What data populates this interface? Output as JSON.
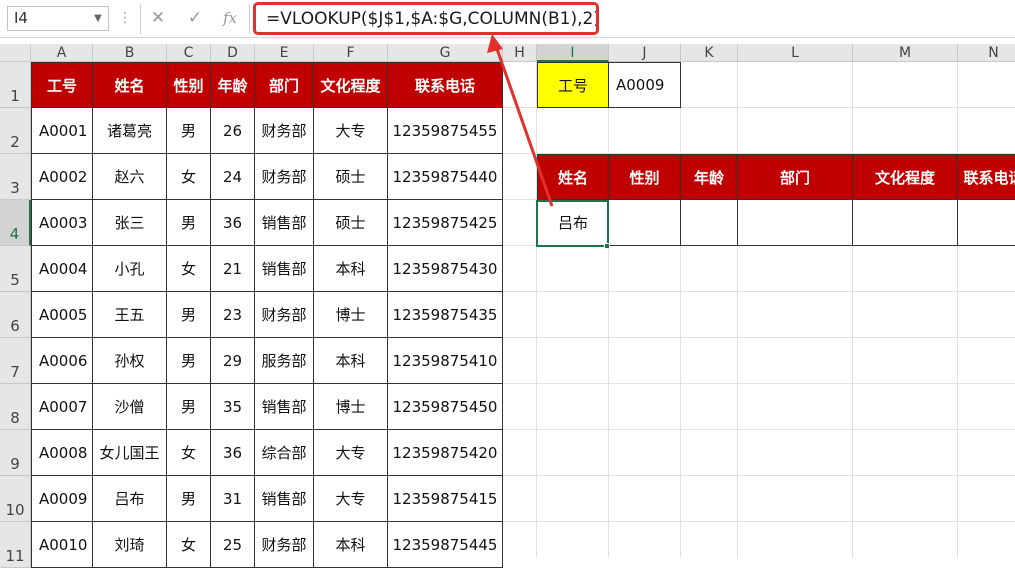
{
  "formula_bar": {
    "name_box": "I4",
    "cancel_icon": "✕",
    "enter_icon": "✓",
    "fx_label": "fx",
    "formula": "=VLOOKUP($J$1,$A:$G,COLUMN(B1),2)"
  },
  "columns": [
    "A",
    "B",
    "C",
    "D",
    "E",
    "F",
    "G",
    "H",
    "I",
    "J",
    "K",
    "L",
    "M",
    "N"
  ],
  "rows": [
    "1",
    "2",
    "3",
    "4",
    "5",
    "6",
    "7",
    "8",
    "9",
    "10",
    "11"
  ],
  "table": {
    "headers": [
      "工号",
      "姓名",
      "性别",
      "年龄",
      "部门",
      "文化程度",
      "联系电话"
    ],
    "records": [
      [
        "A0001",
        "诸葛亮",
        "男",
        "26",
        "财务部",
        "大专",
        "12359875455"
      ],
      [
        "A0002",
        "赵六",
        "女",
        "24",
        "财务部",
        "硕士",
        "12359875440"
      ],
      [
        "A0003",
        "张三",
        "男",
        "36",
        "销售部",
        "硕士",
        "12359875425"
      ],
      [
        "A0004",
        "小孔",
        "女",
        "21",
        "销售部",
        "本科",
        "12359875430"
      ],
      [
        "A0005",
        "王五",
        "男",
        "23",
        "财务部",
        "博士",
        "12359875435"
      ],
      [
        "A0006",
        "孙权",
        "男",
        "29",
        "服务部",
        "本科",
        "12359875410"
      ],
      [
        "A0007",
        "沙僧",
        "男",
        "35",
        "销售部",
        "博士",
        "12359875450"
      ],
      [
        "A0008",
        "女儿国王",
        "女",
        "36",
        "综合部",
        "大专",
        "12359875420"
      ],
      [
        "A0009",
        "吕布",
        "男",
        "31",
        "销售部",
        "大专",
        "12359875415"
      ],
      [
        "A0010",
        "刘琦",
        "女",
        "25",
        "财务部",
        "本科",
        "12359875445"
      ]
    ]
  },
  "lookup": {
    "key_label": "工号",
    "key_value": "A0009",
    "headers": [
      "姓名",
      "性别",
      "年龄",
      "部门",
      "文化程度",
      "联系电话"
    ],
    "result_name": "吕布"
  },
  "colors": {
    "header_red": "#c00000",
    "key_yellow": "#ffff00",
    "annotation_red": "#e0312c",
    "selection_green": "#217346"
  }
}
